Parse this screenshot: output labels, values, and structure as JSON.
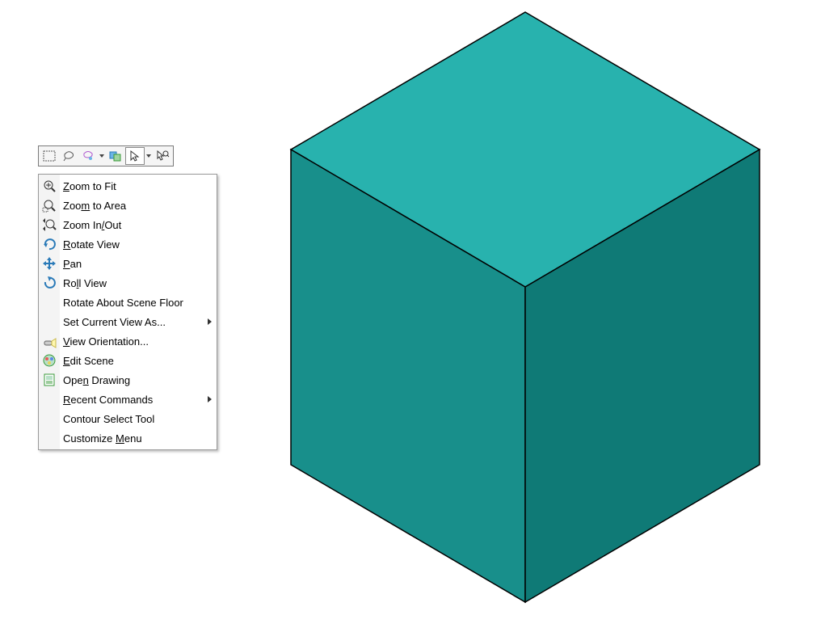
{
  "cube": {
    "top_color": "#28b2ae",
    "left_color": "#188f8b",
    "right_color": "#0f7a76",
    "edge_color": "#000000"
  },
  "toolbar_icons": [
    "box-select-icon",
    "lasso-select-icon",
    "lasso-filter-icon",
    "select-over-geometry-icon",
    "cursor-icon",
    "cursor-magnify-icon"
  ],
  "menu": [
    {
      "icon": "zoom-fit-icon",
      "pre": "",
      "u": "Z",
      "post": "oom to Fit",
      "submenu": false
    },
    {
      "icon": "zoom-area-icon",
      "pre": "Zoo",
      "u": "m",
      "post": " to Area",
      "submenu": false
    },
    {
      "icon": "zoom-inout-icon",
      "pre": "Zoom In",
      "u": "/",
      "post": "Out",
      "submenu": false
    },
    {
      "icon": "rotate-view-icon",
      "pre": "",
      "u": "R",
      "post": "otate View",
      "submenu": false
    },
    {
      "icon": "pan-icon",
      "pre": "",
      "u": "P",
      "post": "an",
      "submenu": false
    },
    {
      "icon": "roll-view-icon",
      "pre": "Ro",
      "u": "l",
      "post": "l View",
      "submenu": false
    },
    {
      "icon": "",
      "pre": "Rotate About Scene Floor",
      "u": "",
      "post": "",
      "submenu": false
    },
    {
      "icon": "",
      "pre": "Set Current View As...",
      "u": "",
      "post": "",
      "submenu": true
    },
    {
      "icon": "flashlight-icon",
      "pre": "",
      "u": "V",
      "post": "iew Orientation...",
      "submenu": false
    },
    {
      "icon": "edit-scene-icon",
      "pre": "",
      "u": "E",
      "post": "dit Scene",
      "submenu": false
    },
    {
      "icon": "open-drawing-icon",
      "pre": "Ope",
      "u": "n",
      "post": " Drawing",
      "submenu": false
    },
    {
      "icon": "",
      "pre": "",
      "u": "R",
      "post": "ecent Commands",
      "submenu": true
    },
    {
      "icon": "",
      "pre": "Contour Select Tool",
      "u": "",
      "post": "",
      "submenu": false
    },
    {
      "icon": "",
      "pre": "Customize ",
      "u": "M",
      "post": "enu",
      "submenu": false
    }
  ]
}
